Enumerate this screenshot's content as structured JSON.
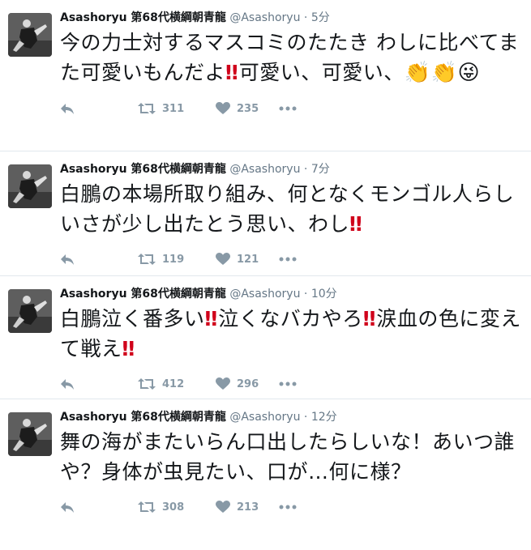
{
  "colors": {
    "name": "#14171a",
    "meta": "#657786",
    "icon": "#8899a6",
    "bangs": "#d0021b",
    "divider": "#e1e8ed"
  },
  "tweets": [
    {
      "name": "Asashoryu 第68代横綱朝青龍",
      "handle": "@Asashoryu",
      "dot": "·",
      "time": "5分",
      "segments": [
        {
          "t": "今の力士対するマスコミのたたき わしに比べてまた可愛いもんだよ"
        },
        {
          "bang": "‼"
        },
        {
          "t": "可愛い、可愛い、"
        },
        {
          "emoji": "👏👏😜"
        }
      ],
      "retweets": "311",
      "likes": "235"
    },
    {
      "name": "Asashoryu 第68代横綱朝青龍",
      "handle": "@Asashoryu",
      "dot": "·",
      "time": "7分",
      "segments": [
        {
          "t": "白鵬の本場所取り組み、何となくモンゴル人らしいさが少し出たとう思い、わし"
        },
        {
          "bang": "‼"
        }
      ],
      "retweets": "119",
      "likes": "121"
    },
    {
      "name": "Asashoryu 第68代横綱朝青龍",
      "handle": "@Asashoryu",
      "dot": "·",
      "time": "10分",
      "segments": [
        {
          "t": "白鵬泣く番多い"
        },
        {
          "bang": "‼"
        },
        {
          "t": "泣くなバカやろ"
        },
        {
          "bang": "‼"
        },
        {
          "t": "涙血の色に変えて戦え"
        },
        {
          "bang": "‼"
        }
      ],
      "retweets": "412",
      "likes": "296"
    },
    {
      "name": "Asashoryu 第68代横綱朝青龍",
      "handle": "@Asashoryu",
      "dot": "·",
      "time": "12分",
      "segments": [
        {
          "t": "舞の海がまたいらん口出したらしいな！あいつ誰や？身体が虫見たい、口が…何に様？"
        }
      ],
      "retweets": "308",
      "likes": "213"
    }
  ]
}
